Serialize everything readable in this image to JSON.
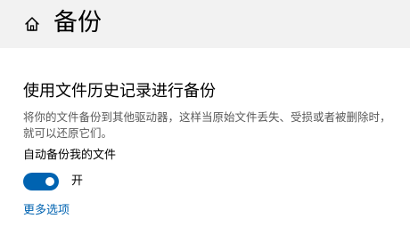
{
  "header": {
    "home_icon": "home-icon",
    "title": "备份"
  },
  "section": {
    "heading": "使用文件历史记录进行备份",
    "description": "将你的文件备份到其他驱动器，这样当原始文件丢失、受损或者被删除时，就可以还原它们。",
    "toggle": {
      "label": "自动备份我的文件",
      "state_text": "开",
      "is_on": true
    },
    "more_options_link": "更多选项"
  },
  "colors": {
    "accent": "#0063b1",
    "header_background": "#f2f2f2",
    "secondary_text": "#5a5a5a"
  }
}
